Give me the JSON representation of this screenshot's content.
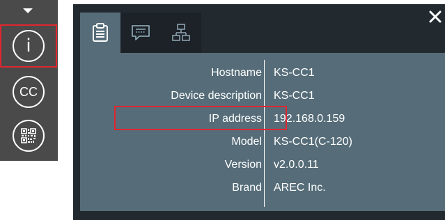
{
  "toolbar": {
    "buttons": [
      {
        "name": "info",
        "label": "i"
      },
      {
        "name": "closed-caption",
        "label": "CC"
      },
      {
        "name": "qr-code",
        "label": ""
      }
    ]
  },
  "panel": {
    "tabs": [
      {
        "name": "device-info",
        "active": true
      },
      {
        "name": "messages",
        "active": false
      },
      {
        "name": "network",
        "active": false
      }
    ],
    "close_label": "×",
    "info_rows": [
      {
        "label": "Hostname",
        "value": "KS-CC1"
      },
      {
        "label": "Device description",
        "value": "KS-CC1"
      },
      {
        "label": "IP address",
        "value": "192.168.0.159"
      },
      {
        "label": "Model",
        "value": "KS-CC1(C-120)"
      },
      {
        "label": "Version",
        "value": "v2.0.0.11"
      },
      {
        "label": "Brand",
        "value": "AREC Inc."
      }
    ]
  },
  "colors": {
    "highlight": "#e0262f",
    "panel_bg": "#222a30",
    "content_bg": "#566d79",
    "toolbar_bg": "#4a4a4a"
  }
}
